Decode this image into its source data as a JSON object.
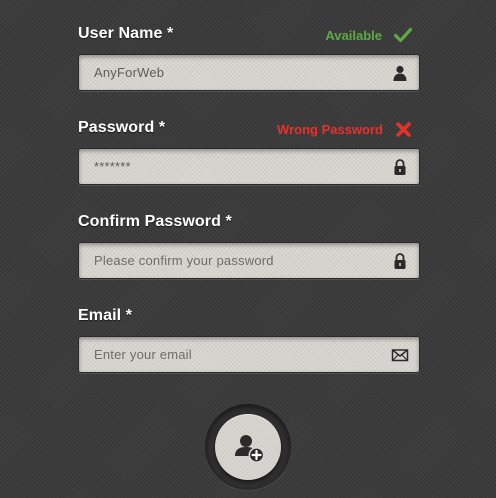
{
  "fields": [
    {
      "label": "User Name *",
      "value": "AnyForWeb",
      "status": {
        "text": "Available",
        "type": "success",
        "icon": "checkmark-icon"
      },
      "icon": "user-icon"
    },
    {
      "label": "Password *",
      "value": "*******",
      "status": {
        "text": "Wrong Password",
        "type": "error",
        "icon": "cross-icon"
      },
      "icon": "lock-icon"
    },
    {
      "label": "Confirm Password *",
      "placeholder": "Please confirm your password",
      "icon": "lock-icon"
    },
    {
      "label": "Email *",
      "placeholder": "Enter your email",
      "icon": "envelope-icon"
    }
  ],
  "submit": {
    "icon": "add-user-icon"
  },
  "colors": {
    "background": "#3b3b3b",
    "input_bg": "#d6d4ce",
    "success": "#5fa844",
    "error": "#e8312b",
    "label": "#ffffff"
  }
}
